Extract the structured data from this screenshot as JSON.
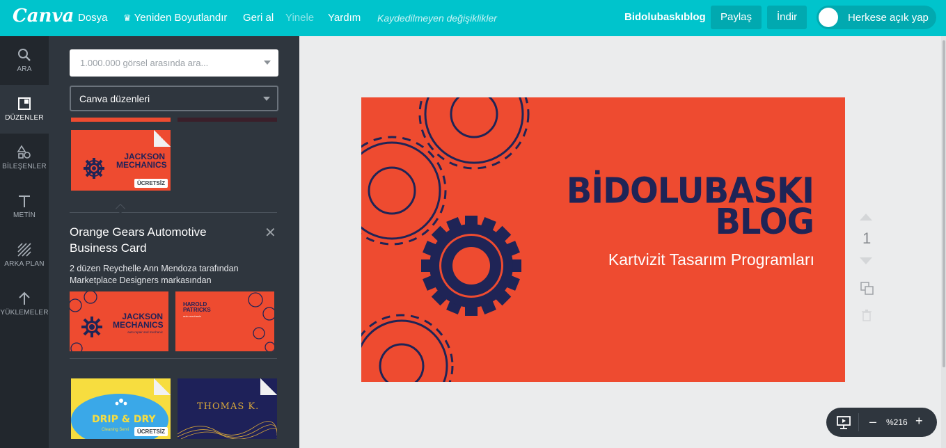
{
  "topbar": {
    "logo": "Canva",
    "menu": {
      "file": "Dosya",
      "resize": "Yeniden Boyutlandır",
      "undo": "Geri al",
      "redo": "Yinele",
      "help": "Yardım"
    },
    "unsaved_note": "Kaydedilmeyen değişiklikler",
    "doc_title": "Bidolubaskıblog",
    "share_label": "Paylaş",
    "download_label": "İndir",
    "public_toggle_label": "Herkese açık yap",
    "public_toggle_on": false
  },
  "rail": {
    "items": [
      {
        "label": "ARA",
        "icon": "search-icon"
      },
      {
        "label": "DÜZENLER",
        "icon": "layouts-icon",
        "active": true
      },
      {
        "label": "BİLEŞENLER",
        "icon": "elements-icon"
      },
      {
        "label": "METİN",
        "icon": "text-icon"
      },
      {
        "label": "ARKA PLAN",
        "icon": "background-icon"
      },
      {
        "label": "YÜKLEMELER",
        "icon": "upload-icon"
      }
    ]
  },
  "panel": {
    "search_placeholder": "1.000.000 görsel arasında ara...",
    "layout_select_value": "Canva düzenleri",
    "free_badge": "ÜCRETSİZ",
    "thumb_jackson": {
      "line1": "JACKSON",
      "line2": "MECHANICS",
      "tagline": "auto repair and mechanic"
    },
    "thumb_harold": {
      "line1": "HAROLD",
      "line2": "PATRICKS",
      "tagline": "auto mechanic"
    },
    "thumb_drip": {
      "title": "DRIP & DRY",
      "sub": "Cleaning Servi"
    },
    "thumb_thomas": {
      "title": "THOMAS K."
    },
    "detail": {
      "title": "Orange Gears Automotive Business Card",
      "subtitle": "2 düzen Reychelle Ann Mendoza tarafından Marketplace Designers markasından"
    }
  },
  "canvas": {
    "page_color": "#ee4b30",
    "title_line1": "BİDOLUBASKI",
    "title_line2": "BLOG",
    "subtitle": "Kartvizit Tasarım Programları",
    "page_number": "1",
    "zoom": "%216"
  },
  "colors": {
    "brand": "#00c4cc",
    "navy": "#1f2456",
    "orange": "#ee4b30"
  }
}
